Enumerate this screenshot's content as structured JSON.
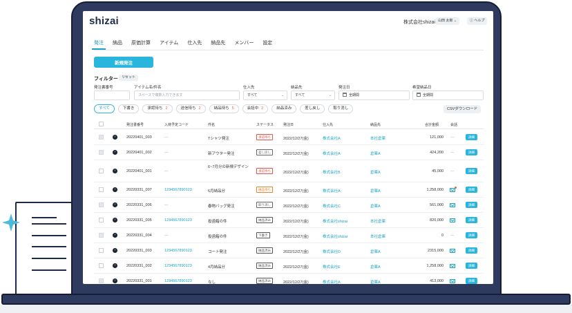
{
  "app": {
    "logo": "shizai",
    "company": "株式会社shizai",
    "user": "山田 太郎 ⌄",
    "help": "ⓘ ヘルプ"
  },
  "tabs": [
    {
      "label": "発注",
      "active": true
    },
    {
      "label": "納品"
    },
    {
      "label": "原価計算"
    },
    {
      "label": "アイテム"
    },
    {
      "label": "仕入先"
    },
    {
      "label": "納品先"
    },
    {
      "label": "メンバー"
    },
    {
      "label": "設定"
    }
  ],
  "new_order_button": "新規発注",
  "filter": {
    "title": "フィルター",
    "reset": "リセット",
    "order_no_label": "発注書番号",
    "item_label": "アイテム名/件名",
    "item_placeholder": "スペースで複数入力できます",
    "supplier_label": "仕入先",
    "supplier_value": "すべて",
    "delivery_label": "納品先",
    "delivery_value": "すべて",
    "order_date_label": "発注日",
    "order_date_value": "全期間",
    "desired_date_label": "希望納品日",
    "desired_date_value": "全期間"
  },
  "status_chips": [
    {
      "label": "すべて",
      "active": true
    },
    {
      "label": "下書き"
    },
    {
      "label": "承認待ち",
      "count": "2"
    },
    {
      "label": "送信待ち",
      "count": "2"
    },
    {
      "label": "納品待ち",
      "count": "5"
    },
    {
      "label": "会話中",
      "count": "2"
    },
    {
      "label": "納品済み"
    },
    {
      "label": "差し戻し"
    },
    {
      "label": "取り消し"
    }
  ],
  "csv_button": "CSVダウンロード",
  "columns": {
    "order_no": "発注書番号",
    "incoming_code": "入荷予定コード",
    "subject": "件名",
    "status": "ステータス",
    "order_date": "発注日",
    "supplier": "仕入先",
    "delivery": "納品先",
    "total": "合計金額",
    "chat": "会話"
  },
  "detail_label": "詳細",
  "colors": {
    "accent": "#2ab6dc",
    "link": "#1aa3c4",
    "laptop": "#2e3a5e",
    "count": "#e86a2a"
  },
  "rows": [
    {
      "no": "20220401_003",
      "code": "—",
      "subject": "Tシャツ発注",
      "status": "承認待ち",
      "status_color": "#e2564a",
      "date": "2022/12/27(金)",
      "supplier": "株式会社A",
      "delivery": "本社倉庫",
      "total": "121,000",
      "chat": "none",
      "disabled": true
    },
    {
      "no": "20220401_002",
      "code": "—",
      "subject": "新アウター発注",
      "status": "差し戻し",
      "status_color": "#666666",
      "date": "2022/12/27(金)",
      "supplier": "株式会社A",
      "delivery": "倉庫A",
      "total": "424,200",
      "chat": "none",
      "disabled": true
    },
    {
      "no": "20220401_001",
      "code": "—",
      "subject": "6~7月分の新規デザイン",
      "status": "承認待ち",
      "status_color": "#e2564a",
      "date": "2022/12/27(金)",
      "supplier": "株式会社B",
      "delivery": "倉庫A",
      "total": "45,000",
      "chat": "none",
      "disabled": false
    },
    {
      "no": "20220331_007",
      "code": "1234567890123",
      "subject": "6月納品分",
      "status": "納品待ち",
      "status_color": "#e8852a",
      "date": "2022/12/27(金)",
      "supplier": "株式会社A",
      "delivery": "倉庫A",
      "total": "1,258,000",
      "chat": "new",
      "disabled": false
    },
    {
      "no": "20220331_006",
      "code": "—",
      "subject": "春物バッグ発注",
      "status": "取り消し",
      "status_color": "#666666",
      "date": "2022/12/27(金)",
      "supplier": "株式会社C",
      "delivery": "倉庫A",
      "total": "561,000",
      "chat": "mail",
      "disabled": true
    },
    {
      "no": "20220331_005",
      "code": "1234567890123",
      "subject": "投函箱の件",
      "status": "納品済み",
      "status_color": "#555555",
      "date": "2022/12/27(金)",
      "supplier": "株式会社shizai",
      "delivery": "本社倉庫",
      "total": "820,000",
      "chat": "mail",
      "disabled": false
    },
    {
      "no": "20220331_004",
      "code": "—",
      "subject": "投函箱の件",
      "status": "下書き",
      "status_color": "#555555",
      "date": "2022/12/27(金)",
      "supplier": "株式会社shizai",
      "delivery": "本社倉庫",
      "total": "0",
      "chat": "none",
      "disabled": true
    },
    {
      "no": "20220331_003",
      "code": "1234567890123",
      "subject": "コート発注",
      "status": "納品済み",
      "status_color": "#555555",
      "date": "2022/12/27(金)",
      "supplier": "株式会社D",
      "delivery": "倉庫A",
      "total": "2315,000",
      "chat": "mail",
      "disabled": false
    },
    {
      "no": "20220331_002",
      "code": "1234567890123",
      "subject": "4月納品分",
      "status": "納品済み",
      "status_color": "#555555",
      "date": "2022/12/27(金)",
      "supplier": "株式会社E",
      "delivery": "倉庫A",
      "total": "1,258,000",
      "chat": "mail",
      "disabled": false
    },
    {
      "no": "20220331_001",
      "code": "1234567890123",
      "subject": "なし",
      "status": "納品済み",
      "status_color": "#555555",
      "date": "2022/12/27(金)",
      "supplier": "株式会社A",
      "delivery": "倉庫A",
      "total": "413,000",
      "chat": "mail",
      "disabled": true
    }
  ]
}
